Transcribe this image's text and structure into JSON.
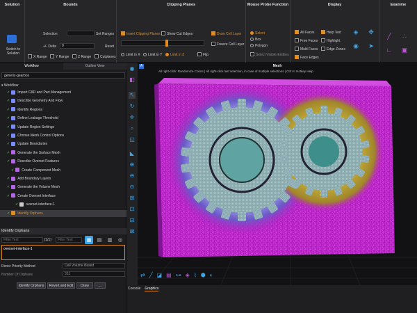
{
  "ribbon": {
    "solution": {
      "title": "Solution",
      "switch_label": "Switch to Solution"
    },
    "bounds": {
      "title": "Bounds",
      "selection_label": "Selection",
      "delta_label": "+/- Delta",
      "delta_value": "0",
      "set_ranges": "Set Ranges",
      "reset": "Reset",
      "x_range": "X Range",
      "y_range": "Y Range",
      "z_range": "Z Range",
      "cutplanes": "Cutplanes"
    },
    "clipping": {
      "title": "Clipping Planes",
      "insert": "Insert Clipping Planes",
      "show_cut_edges": "Show Cut Edges",
      "draw_cell_layer": "Draw Cell Layer",
      "freeze_cell_layer": "Freeze Cell Layer",
      "limit_x": "Limit in X",
      "limit_y": "Limit in Y",
      "limit_z": "Limit in Z",
      "flip": "Flip"
    },
    "probe": {
      "title": "Mouse Probe Function",
      "select": "Select",
      "box": "Box",
      "polygon": "Polygon",
      "visible_entities": "Select Visible Entities"
    },
    "display": {
      "title": "Display",
      "all_faces": "All Faces",
      "free_faces": "Free Faces",
      "multi_faces": "Multi Faces",
      "face_edges": "Face Edges",
      "help_text": "Help Text",
      "highlight": "Highlight",
      "edge_zones": "Edge Zones"
    },
    "examine": {
      "title": "Examine"
    }
  },
  "left": {
    "tabs": [
      "Workflow",
      "Outline View"
    ],
    "combo": "generic-gearbox",
    "workflow_label": "Workflow",
    "tree": [
      {
        "label": "Import CAD and Part Management",
        "indent": 1,
        "color": "#7b8cff"
      },
      {
        "label": "Describe Geometry And Flow",
        "indent": 1,
        "color": "#7b8cff"
      },
      {
        "label": "Identify Regions",
        "indent": 1,
        "color": "#7b8cff"
      },
      {
        "label": "Define Leakage Threshold",
        "indent": 1,
        "color": "#7b8cff"
      },
      {
        "label": "Update Region Settings",
        "indent": 1,
        "color": "#7b8cff"
      },
      {
        "label": "Choose Mesh Control Options",
        "indent": 1,
        "color": "#7b8cff"
      },
      {
        "label": "Update Boundaries",
        "indent": 1,
        "color": "#7b8cff"
      },
      {
        "label": "Generate the Surface Mesh",
        "indent": 1,
        "color": "#b466e6"
      },
      {
        "label": "Describe Overset Features",
        "indent": 1,
        "color": "#b466e6"
      },
      {
        "label": "Create Component Mesh",
        "indent": 2,
        "color": "#b466e6"
      },
      {
        "label": "Add Boundary Layers",
        "indent": 1,
        "color": "#b466e6"
      },
      {
        "label": "Generate the Volume Mesh",
        "indent": 1,
        "color": "#b466e6"
      },
      {
        "label": "Create Overset Interface",
        "indent": 1,
        "color": "#b466e6"
      },
      {
        "label": "overset-interface-1",
        "indent": 3,
        "color": "#cccccc"
      },
      {
        "label": "Identify Orphans",
        "indent": 1,
        "color": "#e28b1e"
      }
    ],
    "identify": {
      "title": "Identify Orphans",
      "filter_placeholder": "Filter Text",
      "count": "[1/1]",
      "filter2_placeholder": "Filter Text",
      "item": "overset-interface-1",
      "donor_label": "Donor Priority Method",
      "donor_value": "Cell Volume Based",
      "orphans_label": "Number Of Orphans",
      "orphans_value": "331",
      "btn_identify": "Identify Orphans",
      "btn_revert": "Revert and Edit",
      "btn_draw": "Draw",
      "btn_more": "..."
    }
  },
  "viewport": {
    "title": "Mesh",
    "hint": "All right-click: Randomize Colors | All right-click last selection, in case of multiple selections | Ctrl H: Hotkey Help"
  },
  "bottom": {
    "tabs": [
      "Console",
      "Graphics"
    ]
  }
}
